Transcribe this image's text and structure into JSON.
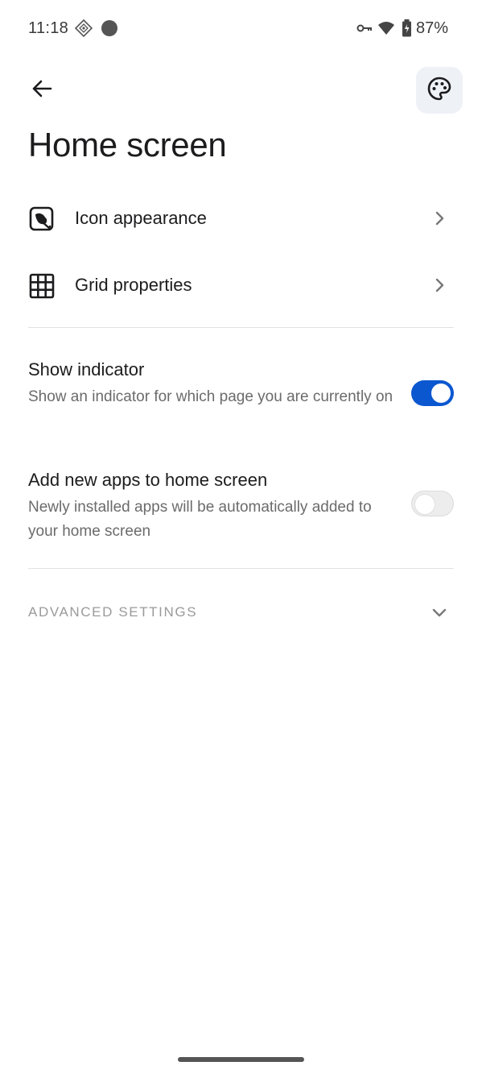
{
  "status_bar": {
    "time": "11:18",
    "battery": "87%",
    "icons": [
      "location-diamond-icon",
      "dot-icon",
      "vpn-key-icon",
      "wifi-icon",
      "battery-icon"
    ]
  },
  "app_bar": {
    "back_icon": "arrow-back-icon",
    "theme_icon": "palette-icon"
  },
  "page": {
    "title": "Home screen"
  },
  "nav_items": [
    {
      "label": "Icon appearance",
      "icon": "icon-appearance-icon"
    },
    {
      "label": "Grid properties",
      "icon": "grid-icon"
    }
  ],
  "toggles": [
    {
      "title": "Show indicator",
      "subtitle": "Show an indicator for which page you are currently on",
      "on": true
    },
    {
      "title": "Add new apps to home screen",
      "subtitle": "Newly installed apps will be automatically added to your home screen",
      "on": false
    }
  ],
  "advanced": {
    "label": "ADVANCED SETTINGS"
  },
  "colors": {
    "accent": "#0b57d0",
    "theme_button_bg": "#eef1f6",
    "subtitle": "#6b6b6b"
  }
}
